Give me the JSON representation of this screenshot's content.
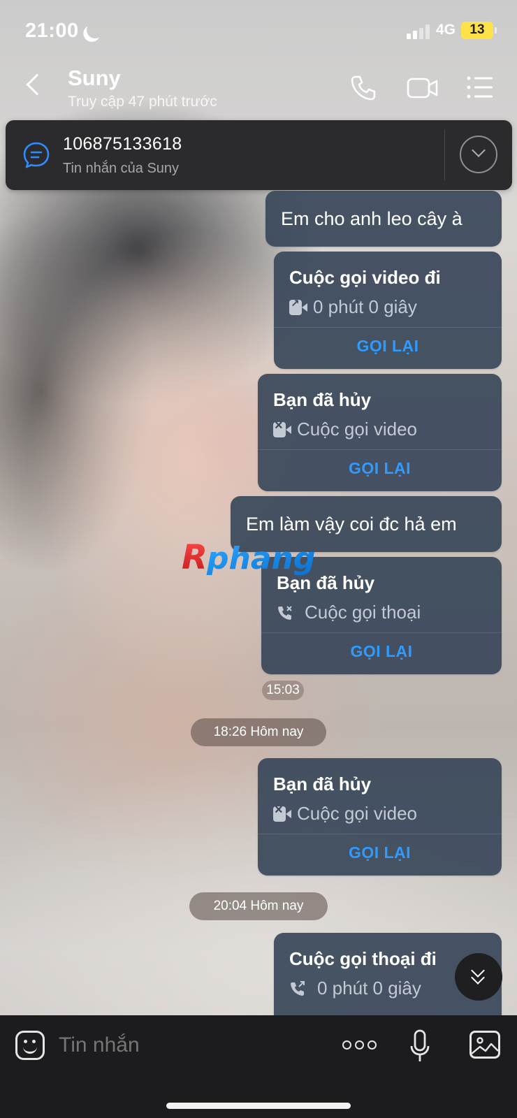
{
  "status_bar": {
    "time": "21:00",
    "network": "4G",
    "battery": "13",
    "icons": [
      "moon-icon",
      "signal-icon",
      "battery-icon"
    ]
  },
  "header": {
    "contact_name": "Suny",
    "last_seen": "Truy cập 47 phút trước",
    "icons": [
      "back-icon",
      "phone-icon",
      "video-camera-icon",
      "menu-icon"
    ]
  },
  "pinned": {
    "title": "106875133618",
    "subtitle": "Tin nhắn của Suny",
    "icon": "chat-bubble-icon"
  },
  "messages": [
    {
      "type": "text",
      "text": "Em cho anh leo cây à"
    },
    {
      "type": "call",
      "title": "Cuộc gọi video đi",
      "detail": "0 phút 0 giây",
      "action": "GỌI LẠI",
      "icon": "outgoing-video-icon"
    },
    {
      "type": "call",
      "title": "Bạn đã hủy",
      "detail": "Cuộc gọi video",
      "action": "GỌI LẠI",
      "icon": "cancelled-video-icon"
    },
    {
      "type": "text",
      "text": "Em làm vậy coi đc hả em"
    },
    {
      "type": "call",
      "title": "Bạn đã hủy",
      "detail": "Cuộc gọi thoại",
      "action": "GỌI LẠI",
      "icon": "cancelled-call-icon"
    },
    {
      "type": "time",
      "text": "15:03"
    },
    {
      "type": "separator",
      "text": "18:26 Hôm nay"
    },
    {
      "type": "call",
      "title": "Bạn đã hủy",
      "detail": "Cuộc gọi video",
      "action": "GỌI LẠI",
      "icon": "cancelled-video-icon"
    },
    {
      "type": "separator",
      "text": "20:04 Hôm nay"
    },
    {
      "type": "call",
      "title": "Cuộc gọi thoại đi",
      "detail": "0 phút 0 giây",
      "icon": "outgoing-call-icon"
    }
  ],
  "watermark": "Rphang",
  "input_bar": {
    "placeholder": "Tin nhắn",
    "icons": [
      "sticker-icon",
      "more-icon",
      "microphone-icon",
      "image-icon"
    ]
  },
  "colors": {
    "bubble": "#3a485a",
    "action": "#2f9bff",
    "input_bar": "#1c1c1e"
  }
}
